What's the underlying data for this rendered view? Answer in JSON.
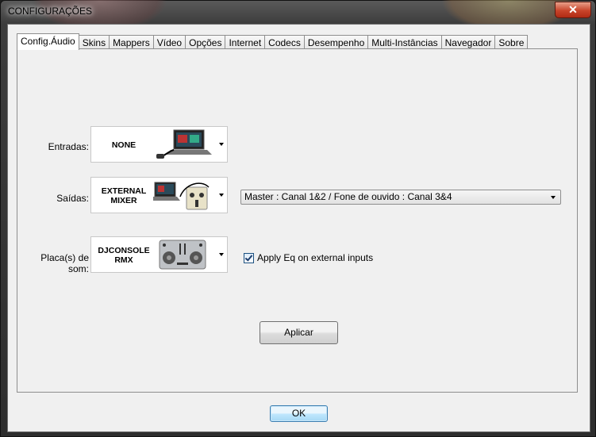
{
  "window": {
    "title": "CONFIGURAÇÕES",
    "close_label": "✕"
  },
  "tabs": [
    {
      "label": "Config.Áudio",
      "active": true
    },
    {
      "label": "Skins"
    },
    {
      "label": "Mappers"
    },
    {
      "label": "Vídeo"
    },
    {
      "label": "Opções"
    },
    {
      "label": "Internet"
    },
    {
      "label": "Codecs"
    },
    {
      "label": "Desempenho"
    },
    {
      "label": "Multi-Instâncias"
    },
    {
      "label": "Navegador"
    },
    {
      "label": "Sobre"
    }
  ],
  "audio": {
    "inputs": {
      "label": "Entradas:",
      "device": "NONE"
    },
    "outputs": {
      "label": "Saídas:",
      "device_line1": "EXTERNAL",
      "device_line2": "MIXER",
      "routing": "Master : Canal 1&2 / Fone de ouvido : Canal 3&4"
    },
    "soundcard": {
      "label": "Placa(s) de som:",
      "device_line1": "DJCONSOLE",
      "device_line2": "RMX",
      "apply_eq_label": "Apply Eq on external inputs",
      "apply_eq_checked": true
    },
    "apply_button": "Aplicar"
  },
  "footer": {
    "ok_button": "OK"
  },
  "icons": {
    "inputs_device": "laptop-cable-icon",
    "outputs_device": "laptop-mixer-icon",
    "soundcard_device": "dj-controller-icon"
  }
}
